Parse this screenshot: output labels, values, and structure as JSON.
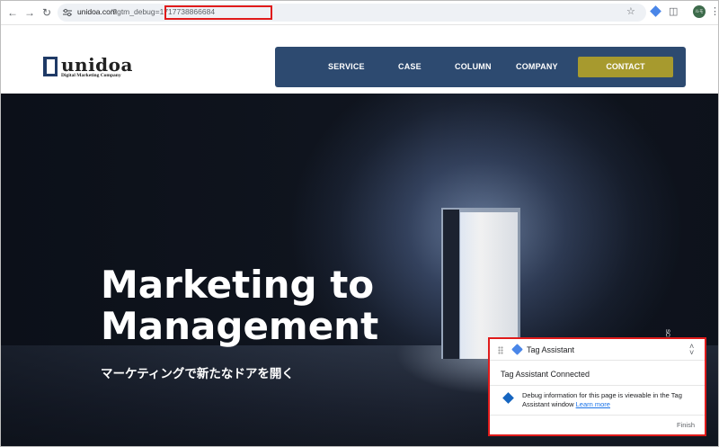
{
  "browser": {
    "url_host": "unidoa.com",
    "url_query": "/?gtm_debug=1717738866684",
    "avatar_initials": "ルモ",
    "icons": [
      "back-icon",
      "forward-icon",
      "reload-icon",
      "tune-icon",
      "star-icon",
      "tag-assistant-extension-icon",
      "puzzle-icon",
      "menu-icon"
    ]
  },
  "site": {
    "logo_text": "unidoa",
    "logo_tagline": "Digital Marketing Company",
    "nav": {
      "service": "SERVICE",
      "case": "CASE",
      "column": "COLUMN",
      "company": "COMPANY",
      "contact": "CONTACT"
    },
    "colors": {
      "nav_bg": "#2d4a70",
      "contact_bg": "#a79a2e"
    }
  },
  "hero": {
    "title_line1": "Marketing to",
    "title_line2": "Management",
    "subtitle": "マーケティングで新たなドアを開く",
    "side_text": "SCROLL"
  },
  "tag_assistant": {
    "title": "Tag Assistant",
    "status": "Tag Assistant Connected",
    "info": "Debug information for this page is viewable in the Tag Assistant window",
    "link": "Learn more",
    "finish": "Finish",
    "highlight_color": "#e01b1b"
  }
}
